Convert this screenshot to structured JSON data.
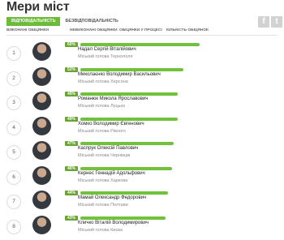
{
  "title": "Мери міст",
  "share": {
    "facebook": "f",
    "twitter": "t"
  },
  "tabs_top": [
    {
      "label": "Відповідальність",
      "active": true
    },
    {
      "label": "Безвідповідальність",
      "active": false
    }
  ],
  "tabs_sub": [
    "Виконані обіцянки",
    "Невиконані обіцянки",
    "Обіцянки у процесі",
    "Кількість обіцянок"
  ],
  "rows": [
    {
      "rank": "1",
      "score": "60%",
      "level": 0.6,
      "name": "Надал Сергій Віталійович",
      "role": "Міський голова Тернополя"
    },
    {
      "rank": "2",
      "score": "52%",
      "level": 0.52,
      "name": "Миколаєнко Володимир Васильович",
      "role": "Міський голова Херсона"
    },
    {
      "rank": "3",
      "score": "49%",
      "level": 0.49,
      "name": "Романюк Микола Ярославович",
      "role": "Міський голова Луцька"
    },
    {
      "rank": "4",
      "score": "49%",
      "level": 0.49,
      "name": "Хомко Володимир Євгенович",
      "role": "Міський голова Рівного"
    },
    {
      "rank": "5",
      "score": "47%",
      "level": 0.47,
      "name": "Каспрук Олексій Павлович",
      "role": "Міський голова Чернівців"
    },
    {
      "rank": "6",
      "score": "46%",
      "level": 0.46,
      "name": "Кернес Геннадій Адольфович",
      "role": "Міський голова Харкова"
    },
    {
      "rank": "7",
      "score": "44%",
      "level": 0.44,
      "name": "Мамай Олександр Федорович",
      "role": "Міський голова Полтави"
    },
    {
      "rank": "8",
      "score": "43%",
      "level": 0.43,
      "name": "Кличко Віталій Володимирович",
      "role": "Міський голова Києва"
    }
  ]
}
